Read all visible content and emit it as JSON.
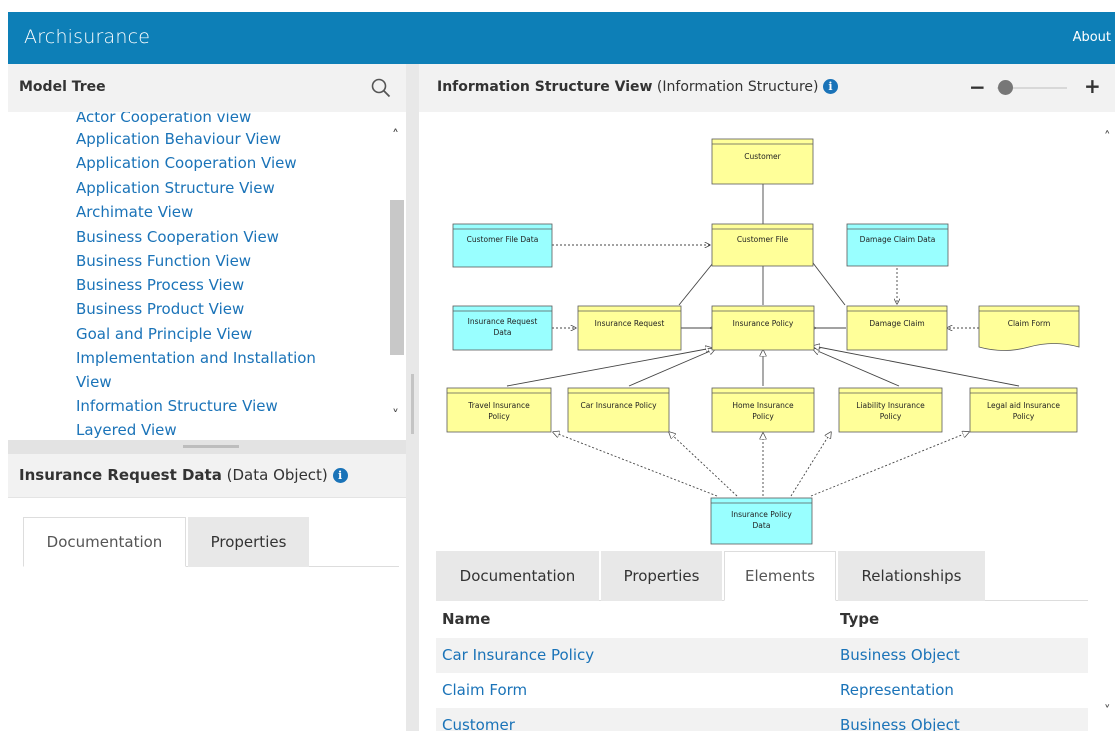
{
  "app": {
    "title": "Archisurance",
    "about": "About"
  },
  "model_tree": {
    "title": "Model Tree",
    "items": [
      "Actor Cooperation view",
      "Application Behaviour View",
      "Application Cooperation View",
      "Application Structure View",
      "Archimate View",
      "Business Cooperation View",
      "Business Function View",
      "Business Process View",
      "Business Product View",
      "Goal and Principle View",
      "Implementation and Installation",
      "View",
      "Information Structure View",
      "Layered View"
    ]
  },
  "properties_panel": {
    "name": "Insurance Request Data",
    "kind": "(Data Object)",
    "tabs": [
      "Documentation",
      "Properties"
    ],
    "active_tab": "Documentation"
  },
  "view": {
    "name": "Information Structure View",
    "viewpoint": "(Information Structure)",
    "zoom_level": 0.12,
    "tabs": [
      "Documentation",
      "Properties",
      "Elements",
      "Relationships"
    ],
    "active_tab": "Elements"
  },
  "diagram": {
    "nodes": {
      "customer": "Customer",
      "customer_file": "Customer File",
      "customer_file_data": "Customer File Data",
      "damage_claim_data": "Damage Claim Data",
      "insurance_request_data_1": "Insurance Request",
      "insurance_request_data_2": "Data",
      "insurance_request": "Insurance Request",
      "insurance_policy": "Insurance Policy",
      "damage_claim": "Damage Claim",
      "claim_form": "Claim Form",
      "travel_1": "Travel  Insurance",
      "travel_2": "Policy",
      "car": "Car Insurance Policy",
      "home_1": "Home Insurance",
      "home_2": "Policy",
      "liability_1": "Liability  Insurance",
      "liability_2": "Policy",
      "legal_1": "Legal aid  Insurance",
      "legal_2": "Policy",
      "policy_data_1": "Insurance Policy",
      "policy_data_2": "Data"
    },
    "colors": {
      "business_object": "#ffff99",
      "data_object": "#99ffff",
      "border": "#5a5a5a"
    }
  },
  "elements_table": {
    "columns": [
      "Name",
      "Type"
    ],
    "rows": [
      {
        "name": "Car Insurance Policy",
        "type": "Business Object"
      },
      {
        "name": "Claim Form",
        "type": "Representation"
      },
      {
        "name": "Customer",
        "type": "Business Object"
      }
    ]
  },
  "icons": [
    "search-icon",
    "info-icon",
    "zoom-out-icon",
    "zoom-in-icon",
    "scroll-up-icon",
    "scroll-down-icon"
  ]
}
